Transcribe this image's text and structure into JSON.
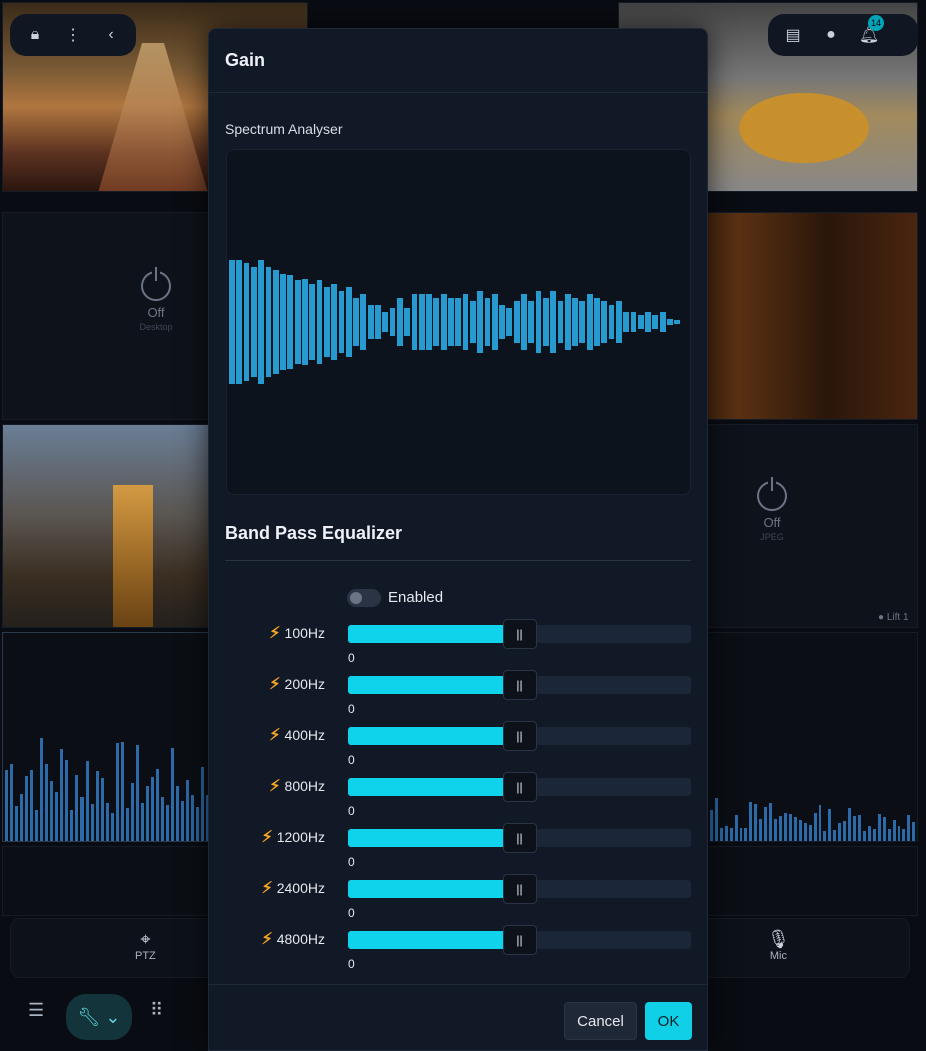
{
  "background": {
    "tiles": {
      "off_desktop": {
        "state": "Off",
        "name": "Desktop"
      },
      "off_jpeg": {
        "state": "Off",
        "name": "JPEG"
      },
      "lift_label": "Lift 1"
    },
    "notification_count": "14",
    "bottom_bar": {
      "ptz_label": "PTZ",
      "mic_label": "Mic"
    }
  },
  "modal": {
    "title": "Gain",
    "spectrum": {
      "label": "Spectrum Analyser",
      "bar_color": "#279bd0",
      "levels": [
        0.36,
        0.36,
        0.34,
        0.32,
        0.36,
        0.32,
        0.3,
        0.28,
        0.27,
        0.24,
        0.25,
        0.22,
        0.24,
        0.2,
        0.22,
        0.18,
        0.2,
        0.14,
        0.16,
        0.1,
        0.1,
        0.06,
        0.08,
        0.14,
        0.08,
        0.16,
        0.16,
        0.16,
        0.14,
        0.16,
        0.14,
        0.14,
        0.16,
        0.12,
        0.18,
        0.14,
        0.16,
        0.1,
        0.08,
        0.12,
        0.16,
        0.12,
        0.18,
        0.14,
        0.18,
        0.12,
        0.16,
        0.14,
        0.12,
        0.16,
        0.14,
        0.12,
        0.1,
        0.12,
        0.06,
        0.06,
        0.04,
        0.06,
        0.04,
        0.06,
        0.02,
        0.01
      ]
    },
    "equalizer": {
      "title": "Band Pass Equalizer",
      "enabled_label": "Enabled",
      "enabled": false,
      "fill_color": "#0fd3ea",
      "thumb_symbol": "||",
      "bands": [
        {
          "label": "100Hz",
          "value": "0",
          "level": 0.5
        },
        {
          "label": "200Hz",
          "value": "0",
          "level": 0.5
        },
        {
          "label": "400Hz",
          "value": "0",
          "level": 0.5
        },
        {
          "label": "800Hz",
          "value": "0",
          "level": 0.5
        },
        {
          "label": "1200Hz",
          "value": "0",
          "level": 0.5
        },
        {
          "label": "2400Hz",
          "value": "0",
          "level": 0.5
        },
        {
          "label": "4800Hz",
          "value": "0",
          "level": 0.5
        }
      ]
    },
    "buttons": {
      "cancel": "Cancel",
      "ok": "OK"
    }
  }
}
